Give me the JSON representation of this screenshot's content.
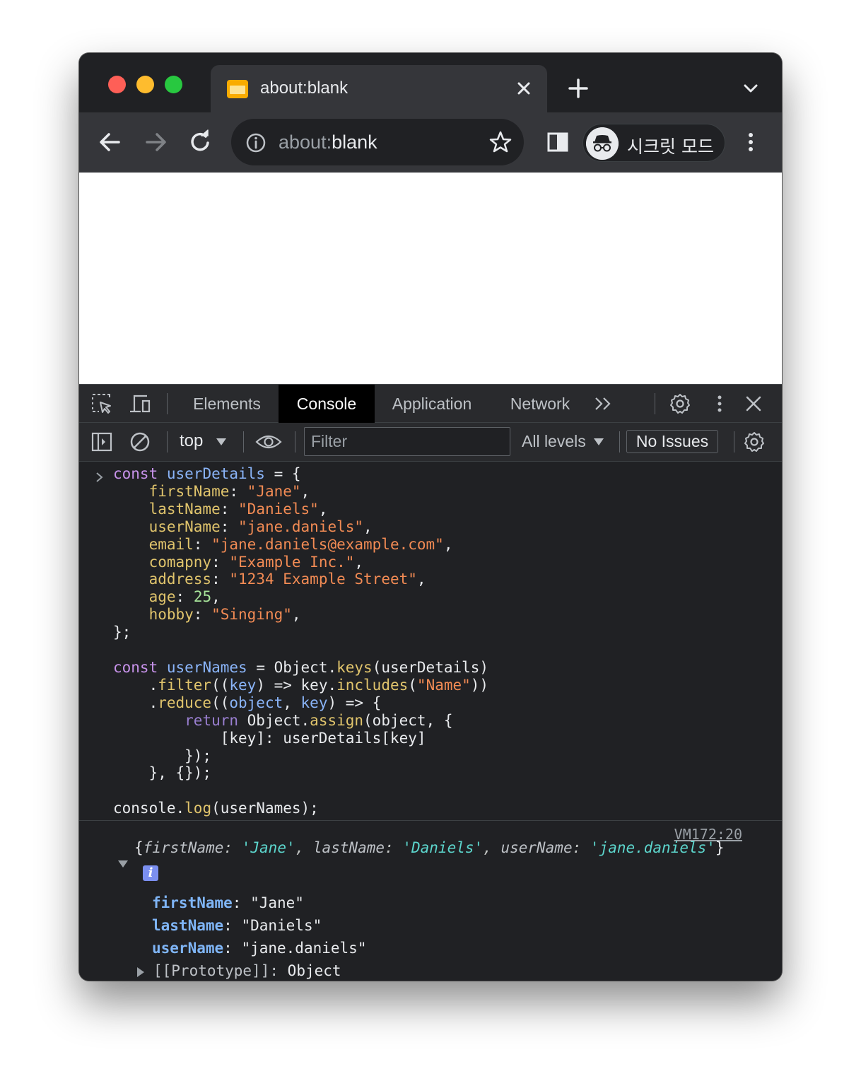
{
  "tab": {
    "title": "about:blank"
  },
  "omnibox": {
    "url_dim": "about:",
    "url_bright": "blank"
  },
  "incognito": {
    "label": "시크릿 모드"
  },
  "devtools": {
    "tabs": [
      "Elements",
      "Console",
      "Application",
      "Network"
    ],
    "active_tab": "Console",
    "context": "top",
    "filter_placeholder": "Filter",
    "levels": "All levels",
    "issues": "No Issues"
  },
  "console": {
    "source_link": "VM172:20",
    "summary": {
      "open": "{",
      "k1": "firstName",
      "v1": "'Jane'",
      "k2": "lastName",
      "v2": "'Daniels'",
      "k3": "userName",
      "v3": "'jane.daniels'",
      "close": "}"
    },
    "info_badge": "i",
    "properties": [
      {
        "key": "firstName",
        "value": "\"Jane\""
      },
      {
        "key": "lastName",
        "value": "\"Daniels\""
      },
      {
        "key": "userName",
        "value": "\"jane.daniels\""
      }
    ],
    "prototype_key": "[[Prototype]]",
    "prototype_value": "Object"
  },
  "colors": {
    "chrome_dark": "#202124",
    "chrome_toolbar": "#35363a",
    "devtools_bg": "#202124",
    "keyword": "#c792ea",
    "variable": "#8ab4f8",
    "property": "#e0c46c",
    "string": "#f28b54",
    "number": "#a7e49a"
  }
}
